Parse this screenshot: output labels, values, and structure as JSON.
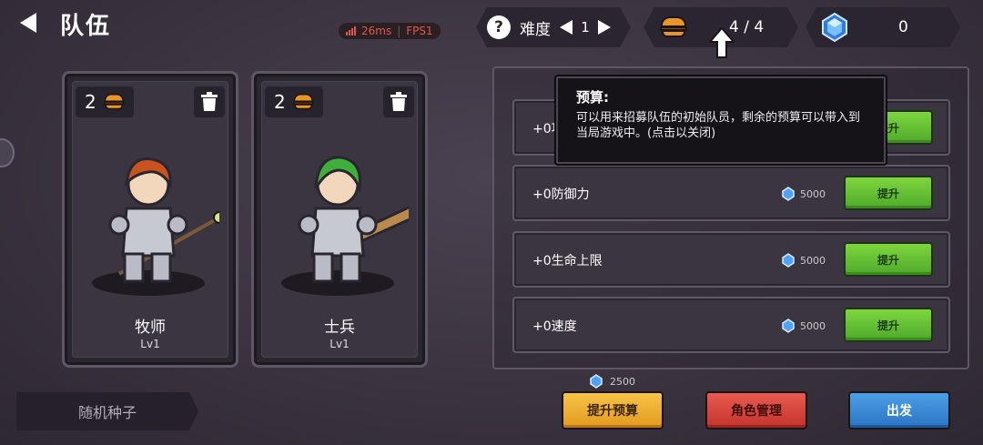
{
  "header": {
    "title": "队伍"
  },
  "perf": {
    "latency": "26ms",
    "fps": "FPS1",
    "colors": {
      "text": "#e2574c"
    }
  },
  "hud": {
    "difficulty_label": "难度",
    "difficulty_value": "1",
    "budget": "4 / 4",
    "gems": "0",
    "icons": [
      "question-icon",
      "arrow-left-icon",
      "arrow-right-icon",
      "burger-coin-icon",
      "gem-icon"
    ]
  },
  "heroes": [
    {
      "cost": "2",
      "name": "牧师",
      "level": "Lv1",
      "hair_color": "#c9521f"
    },
    {
      "cost": "2",
      "name": "士兵",
      "level": "Lv1",
      "hair_color": "#3fae3a"
    }
  ],
  "seed": {
    "label": "随机种子"
  },
  "tooltip": {
    "title": "预算:",
    "body": "可以用来招募队伍的初始队员，剩余的预算可以带入到当局游戏中。(点击以关闭)"
  },
  "stats": [
    {
      "label": "+0攻",
      "cost": "",
      "button": "提升"
    },
    {
      "label": "+0防御力",
      "cost": "5000",
      "button": "提升"
    },
    {
      "label": "+0生命上限",
      "cost": "5000",
      "button": "提升"
    },
    {
      "label": "+0速度",
      "cost": "5000",
      "button": "提升"
    }
  ],
  "bottom": {
    "budget_cost": "2500",
    "upgrade_budget": "提升预算",
    "role_management": "角色管理",
    "depart": "出发"
  },
  "colors": {
    "green_button": "#6cc536",
    "yellow_button": "#f0b53a",
    "red_button": "#d8453e",
    "blue_button": "#3a8bd6",
    "gem": "#4fa3ff"
  }
}
